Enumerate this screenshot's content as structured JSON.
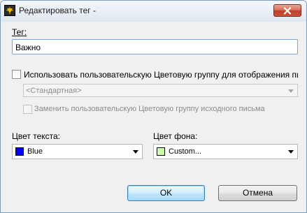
{
  "window": {
    "title": "Редактировать тег -",
    "icons": {
      "app": "tag-app-icon",
      "close": "close-x-icon"
    }
  },
  "tag": {
    "label": "Тег:",
    "value": "Важно"
  },
  "color_group": {
    "checkbox_label": "Использовать пользовательскую Цветовую группу для отображения писем",
    "checked": false,
    "dropdown_value": "<Стандартная>",
    "replace_label": "Заменить пользовательскую Цветовую группу исходного письма",
    "replace_checked": false
  },
  "text_color": {
    "label": "Цвет текста:",
    "value": "Blue",
    "swatch": "#0000ff"
  },
  "bg_color": {
    "label": "Цвет фона:",
    "value": "Custom...",
    "swatch": "#ccffaa"
  },
  "buttons": {
    "ok": "OK",
    "cancel": "Отмена"
  },
  "colors": {
    "focus_border": "#7aa7d6",
    "default_button": "#3c7fb1",
    "close_button": "#c9533c"
  }
}
